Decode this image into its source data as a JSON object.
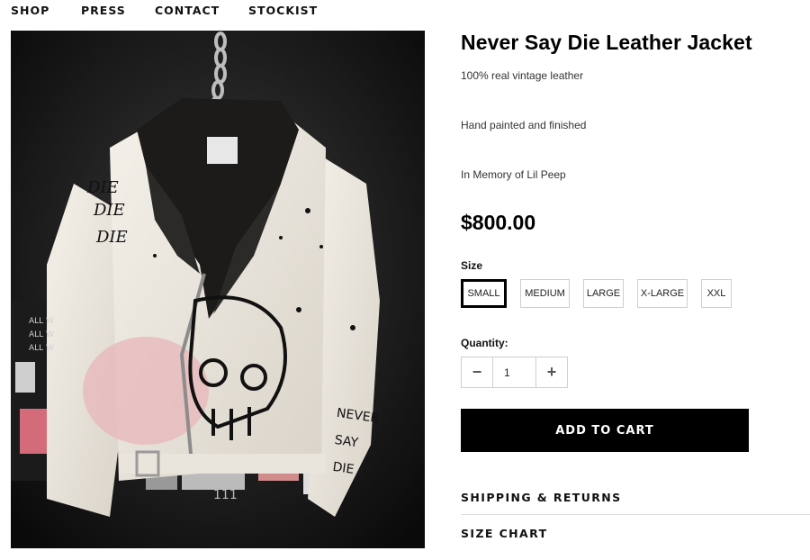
{
  "nav": {
    "items": [
      "SHOP",
      "PRESS",
      "CONTACT",
      "STOCKIST"
    ]
  },
  "product": {
    "title": "Never Say Die Leather Jacket",
    "descriptions": [
      "100% real vintage leather",
      "Hand painted and finished",
      "In Memory of Lil Peep"
    ],
    "price": "$800.00",
    "image_alt": "Never Say Die Leather Jacket",
    "jacket_text": [
      "DIE",
      "DIE",
      "DIE",
      "NEVER",
      "SAY",
      "DIE",
      "ALL W",
      "ALL W",
      "ALL W",
      "111"
    ]
  },
  "size": {
    "label": "Size",
    "options": [
      "SMALL",
      "MEDIUM",
      "LARGE",
      "X-LARGE",
      "XXL"
    ],
    "selected": "SMALL"
  },
  "quantity": {
    "label": "Quantity:",
    "value": "1",
    "minus_icon": "minus-icon",
    "plus_icon": "plus-icon"
  },
  "cart": {
    "add_label": "ADD TO CART"
  },
  "accordion": {
    "shipping": "SHIPPING & RETURNS",
    "size_chart": "SIZE CHART"
  },
  "colors": {
    "accent": "#000000",
    "border": "#cfcfcf",
    "text": "#111111"
  }
}
